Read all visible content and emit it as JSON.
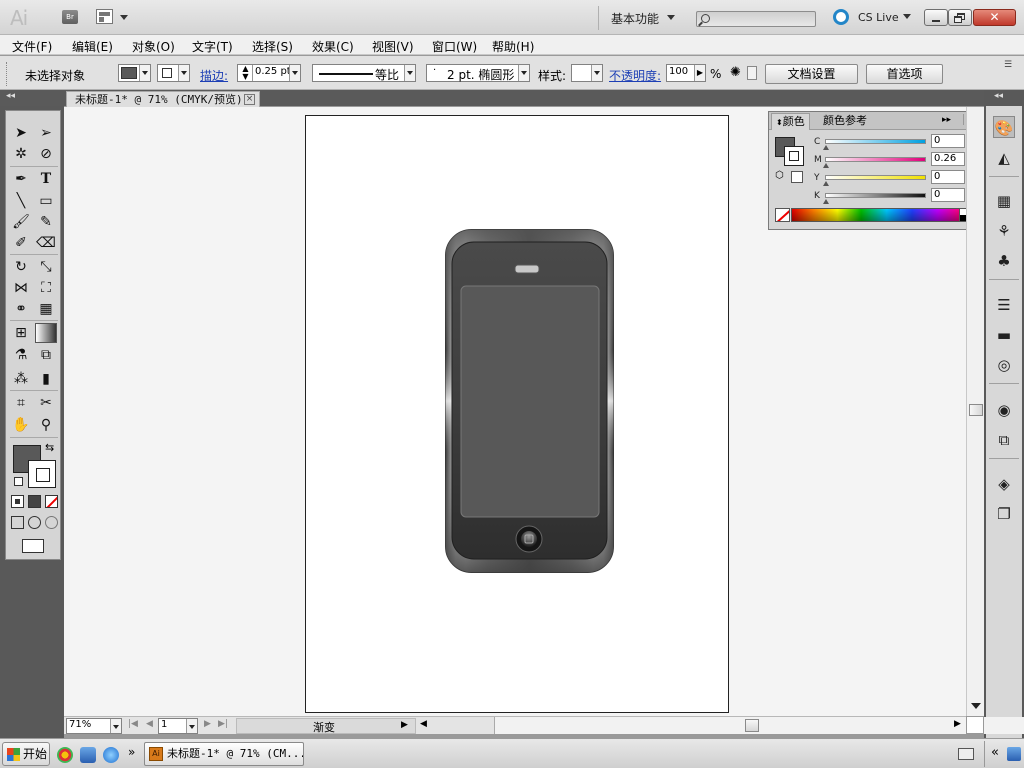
{
  "app": {
    "logo_text": "Ai",
    "bridge_label": "Br"
  },
  "titlebar": {
    "workspace": "基本功能",
    "cs_live": "CS Live",
    "close_glyph": "✕"
  },
  "menu": [
    "文件(F)",
    "编辑(E)",
    "对象(O)",
    "文字(T)",
    "选择(S)",
    "效果(C)",
    "视图(V)",
    "窗口(W)",
    "帮助(H)"
  ],
  "control_bar": {
    "selection_status": "未选择对象",
    "stroke_label": "描边:",
    "stroke_weight": "0.25 pt",
    "stroke_profile": "等比",
    "brush": "2 pt. 椭圆形",
    "style_label": "样式:",
    "opacity_label": "不透明度:",
    "opacity_value": "100",
    "opacity_unit": "%",
    "doc_setup_button": "文档设置",
    "preferences_button": "首选项",
    "fill_color": "#595959"
  },
  "document": {
    "tab_title": "未标题-1* @ 71% (CMYK/预览)",
    "close_glyph": "×"
  },
  "tools": {
    "fill_color": "#595959",
    "stroke_color": "#ffffff"
  },
  "color_panel": {
    "tab_color": "颜色",
    "tab_color_guide": "颜色参考",
    "channels": [
      {
        "label": "C",
        "value": "0",
        "unit": "%",
        "gradient_end": "#00a0e0"
      },
      {
        "label": "M",
        "value": "0.26",
        "unit": "%",
        "gradient_end": "#e0007a"
      },
      {
        "label": "Y",
        "value": "0",
        "unit": "%",
        "gradient_end": "#f0e000"
      },
      {
        "label": "K",
        "value": "0",
        "unit": "%",
        "gradient_end": "#111111"
      }
    ]
  },
  "status_bar": {
    "zoom": "71%",
    "page": "1",
    "status_text": "渐变"
  },
  "taskbar": {
    "start": "开始",
    "chevron": "»",
    "window_label": "未标题-1* @ 71% (CM...",
    "ai_badge": "Ai"
  }
}
